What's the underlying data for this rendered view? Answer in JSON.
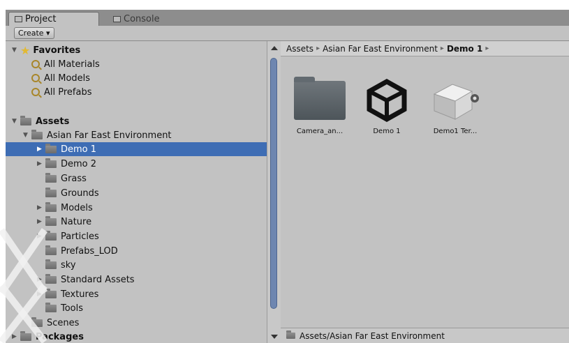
{
  "tabs": [
    {
      "label": "Project",
      "active": true
    },
    {
      "label": "Console",
      "active": false
    }
  ],
  "toolbar": {
    "create_label": "Create ▾"
  },
  "tree": [
    {
      "label": "Favorites",
      "icon": "star-icon",
      "bold": true,
      "foldout": "▼",
      "level": 0
    },
    {
      "label": "All Materials",
      "icon": "search-icon",
      "level": 1
    },
    {
      "label": "All Models",
      "icon": "search-icon",
      "level": 1
    },
    {
      "label": "All Prefabs",
      "icon": "search-icon",
      "level": 1
    },
    {
      "label": "Assets",
      "icon": "folder-icon",
      "bold": true,
      "foldout": "▼",
      "level": 0
    },
    {
      "label": "Asian Far East Environment",
      "icon": "folder-icon",
      "foldout": "▼",
      "level": 1
    },
    {
      "label": "Demo 1",
      "icon": "folder-icon",
      "foldout": "▶",
      "level": 2,
      "selected": true
    },
    {
      "label": "Demo 2",
      "icon": "folder-icon",
      "foldout": "▶",
      "level": 2
    },
    {
      "label": "Grass",
      "icon": "folder-icon",
      "level": 2
    },
    {
      "label": "Grounds",
      "icon": "folder-icon",
      "level": 2
    },
    {
      "label": "Models",
      "icon": "folder-icon",
      "foldout": "▶",
      "level": 2
    },
    {
      "label": "Nature",
      "icon": "folder-icon",
      "foldout": "▶",
      "level": 2
    },
    {
      "label": "Particles",
      "icon": "folder-icon",
      "foldout": "▶",
      "level": 2
    },
    {
      "label": "Prefabs_LOD",
      "icon": "folder-icon",
      "level": 2
    },
    {
      "label": "sky",
      "icon": "folder-icon",
      "level": 2
    },
    {
      "label": "Standard Assets",
      "icon": "folder-icon",
      "foldout": "▶",
      "level": 2
    },
    {
      "label": "Textures",
      "icon": "folder-icon",
      "foldout": "▶",
      "level": 2
    },
    {
      "label": "Tools",
      "icon": "folder-icon",
      "level": 2
    },
    {
      "label": "Scenes",
      "icon": "folder-icon",
      "level": 1
    },
    {
      "label": "Packages",
      "icon": "folder-icon",
      "bold": true,
      "foldout": "▶",
      "level": 0
    }
  ],
  "breadcrumb": {
    "items": [
      "Assets",
      "Asian Far East Environment",
      "Demo 1"
    ],
    "separator": "▸"
  },
  "assets": [
    {
      "label": "Camera_an...",
      "icon": "folder-icon"
    },
    {
      "label": "Demo 1",
      "icon": "unity-scene-icon"
    },
    {
      "label": "Demo1 Ter...",
      "icon": "terrain-data-icon"
    }
  ],
  "status": {
    "path": "Assets/Asian Far East Environment"
  },
  "colors": {
    "selection": "#3e6db4",
    "panel": "#c2c2c2",
    "tabbar": "#8d8d8d"
  }
}
